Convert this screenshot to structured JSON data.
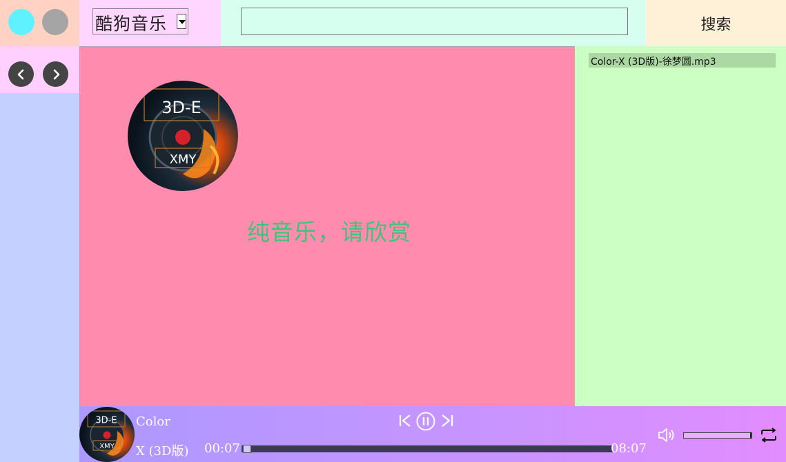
{
  "header": {
    "window_controls": [
      "cyan-dot",
      "gray-dot"
    ],
    "source_select": {
      "selected": "酷狗音乐"
    },
    "search": {
      "value": "",
      "placeholder": ""
    },
    "search_button_label": "搜索"
  },
  "nav": {
    "back_icon": "chevron-left-icon",
    "forward_icon": "chevron-right-icon"
  },
  "album_art": {
    "top_text": "3D-E",
    "bottom_text": "XMY"
  },
  "main": {
    "lyrics_text": "纯音乐，请欣赏"
  },
  "playlist": {
    "items": [
      {
        "label": "Color-X (3D版)-徐梦圆.mp3"
      }
    ]
  },
  "player": {
    "title_line1": "Color",
    "title_line2": "X (3D版)",
    "time_elapsed": "00:07",
    "time_total": "08:07",
    "progress_fraction": 0.014,
    "volume_fraction": 0.98,
    "icons": {
      "prev": "skip-previous-icon",
      "play_pause": "pause-icon",
      "next": "skip-next-icon",
      "volume": "volume-icon",
      "loop": "repeat-icon"
    }
  },
  "colors": {
    "main_area": "#ff8cae",
    "lyrics": "#3ec47a",
    "playlist_bg": "#ccffc4",
    "player_gradient_start": "#ac98ff",
    "player_gradient_end": "#e28cff"
  }
}
